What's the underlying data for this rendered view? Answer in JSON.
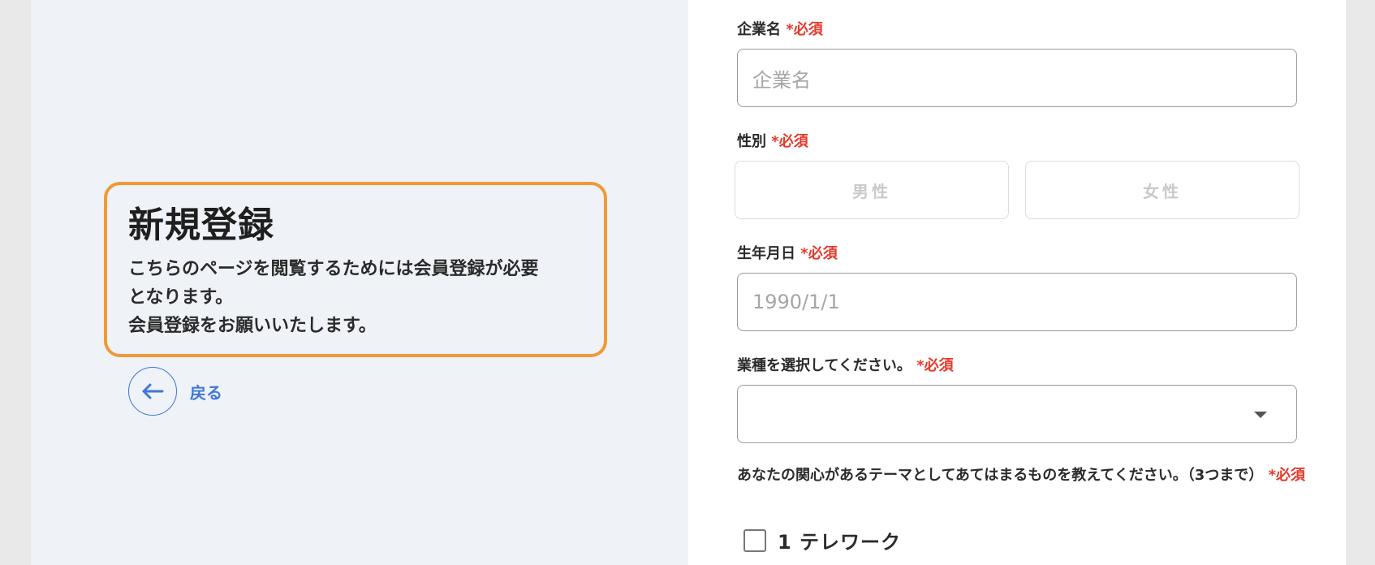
{
  "intro": {
    "title": "新規登録",
    "line1": "こちらのページを閲覧するためには会員登録が必要",
    "line2": "となります。",
    "line3": "会員登録をお願いいたします。"
  },
  "back": {
    "label": "戻る",
    "icon": "arrow-left-icon"
  },
  "required_mark": "*必須",
  "form": {
    "company": {
      "label": "企業名",
      "placeholder": "企業名"
    },
    "gender": {
      "label": "性別",
      "options": [
        "男性",
        "女性"
      ]
    },
    "birthday": {
      "label": "生年月日",
      "placeholder": "1990/1/1"
    },
    "industry": {
      "label": "業種を選択してください。",
      "value": ""
    },
    "interests": {
      "label": "あなたの関心があるテーマとしてあてはまるものを教えてください。（3つまで）",
      "options": [
        {
          "label": "1 テレワーク",
          "checked": false
        }
      ]
    }
  },
  "colors": {
    "accent": "#3f77d6",
    "required": "#e53a2c",
    "intro_border": "#ef9a36",
    "left_bg": "#eff2f7"
  }
}
